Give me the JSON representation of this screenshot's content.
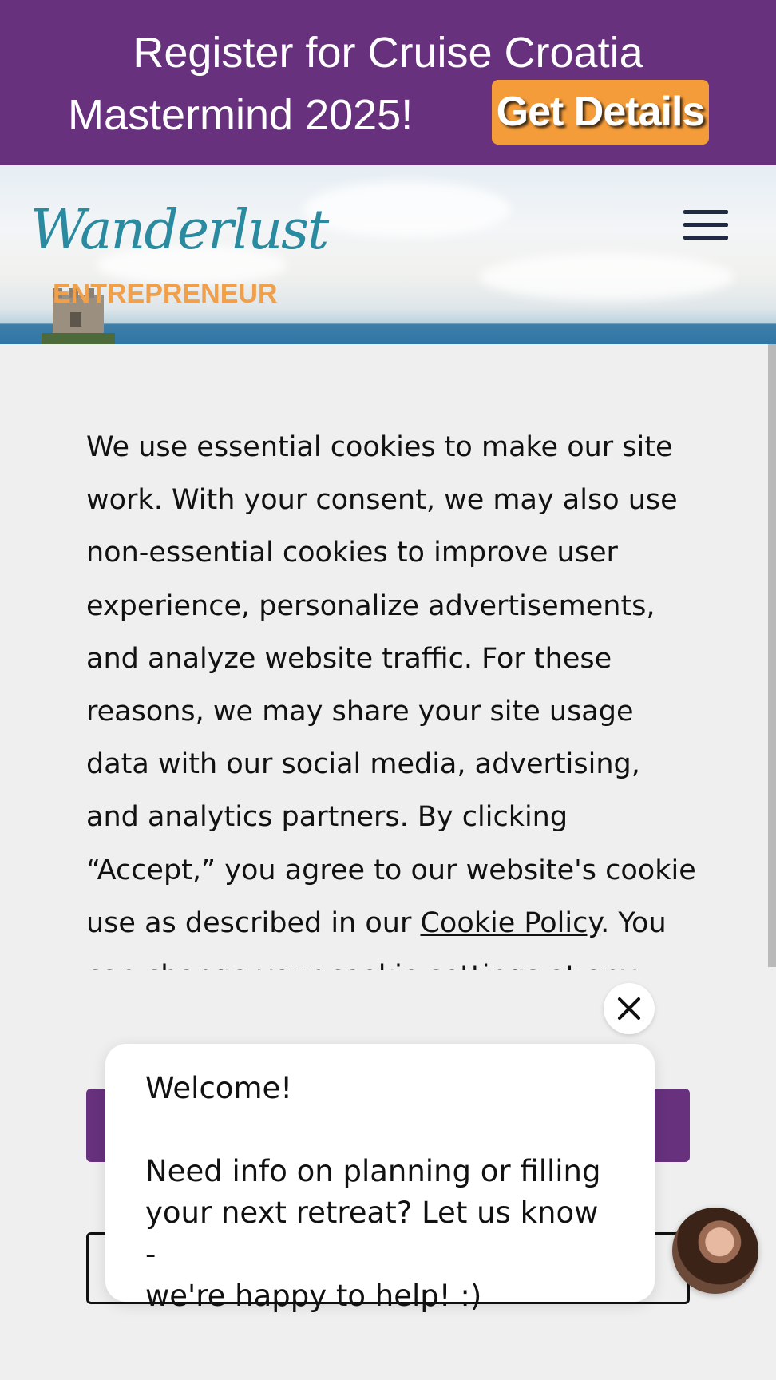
{
  "promo": {
    "line1": "Register for Cruise Croatia",
    "line2": "Mastermind 2025!",
    "button_label": "Get Details",
    "background_color": "#67317d",
    "button_color": "#f49c3a"
  },
  "header": {
    "logo_script": "Wanderlust",
    "logo_subtitle": "ENTREPRENEUR",
    "menu_icon": "hamburger-icon"
  },
  "cookie": {
    "text_before_link": "We use essential cookies to make our site work. With your consent, we may also use non-essential cookies to improve user experience, personalize advertisements, and analyze website traffic. For these reasons, we may share your site usage data with our social media, advertising, and analytics partners. By clicking “Accept,” you agree to our website's cookie use as described in our ",
    "link_text": "Cookie Policy",
    "text_after_link": ". You can change your cookie settings at any time by clicking “Preferences.”",
    "accept_color": "#67317d"
  },
  "chat": {
    "greeting": "Welcome!",
    "message_line1": "Need info on planning or filling",
    "message_line2": "your next retreat? Let us know -",
    "message_line3": "we're happy to help! :)",
    "close_icon": "close-icon",
    "avatar_icon": "agent-avatar"
  }
}
